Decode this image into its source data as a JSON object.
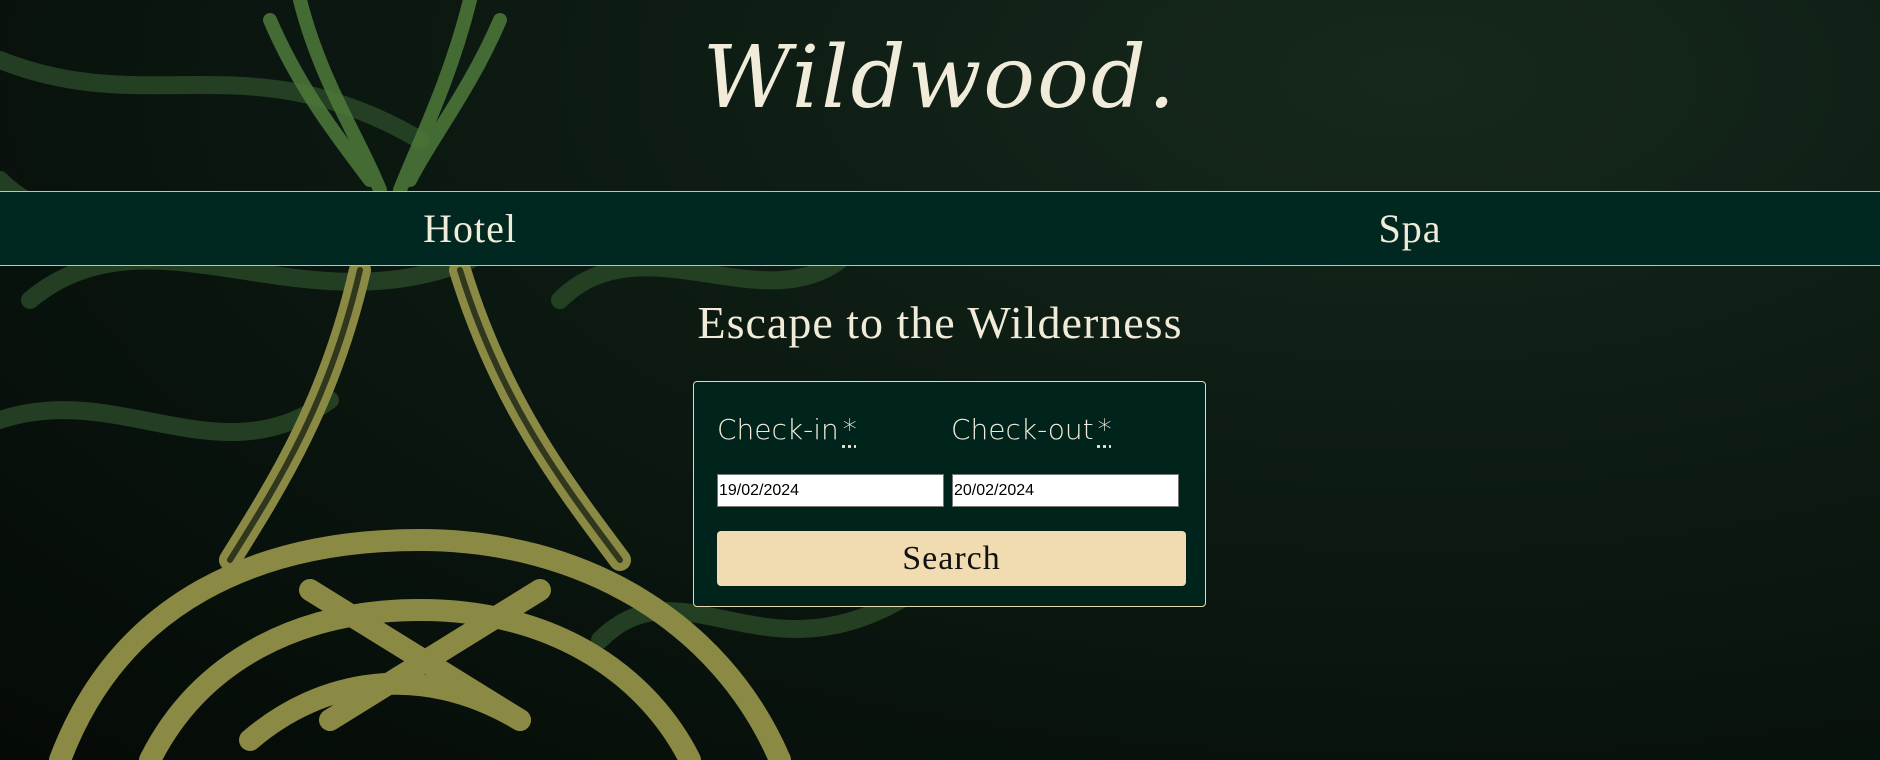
{
  "brand": {
    "logo_text": "Wildwood."
  },
  "nav": {
    "items": [
      {
        "label": "Hotel"
      },
      {
        "label": "Spa"
      }
    ]
  },
  "hero": {
    "headline": "Escape to the Wilderness"
  },
  "booking": {
    "checkin": {
      "label": "Check-in",
      "required_mark": "*",
      "value": "19/02/2024"
    },
    "checkout": {
      "label": "Check-out",
      "required_mark": "*",
      "value": "20/02/2024"
    },
    "search_label": "Search"
  },
  "colors": {
    "nav_bg": "#012820",
    "panel_bg": "#00231c",
    "button_bg": "#f1dbb1",
    "text": "#f1ecd9"
  }
}
